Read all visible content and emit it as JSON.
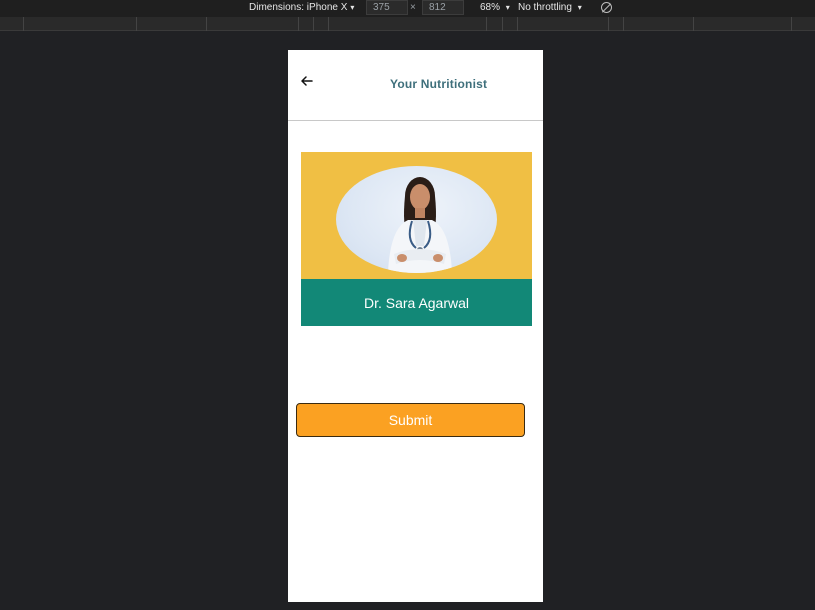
{
  "devtools": {
    "dimensions_label": "Dimensions: iPhone X",
    "width_value": "375",
    "times_symbol": "×",
    "height_value": "812",
    "zoom_label": "68%",
    "throttling_label": "No throttling",
    "caret": "▾",
    "rotate_icon": "rotate-icon"
  },
  "app": {
    "title": "Your Nutritionist",
    "back_icon": "arrow-left-icon",
    "nutritionist": {
      "name": "Dr. Sara Agarwal",
      "photo": "doctor-portrait-image"
    },
    "submit_label": "Submit",
    "colors": {
      "card_top": "#f0bf44",
      "card_bottom": "#128877",
      "submit": "#fba122",
      "title": "#3e6f7b"
    }
  }
}
